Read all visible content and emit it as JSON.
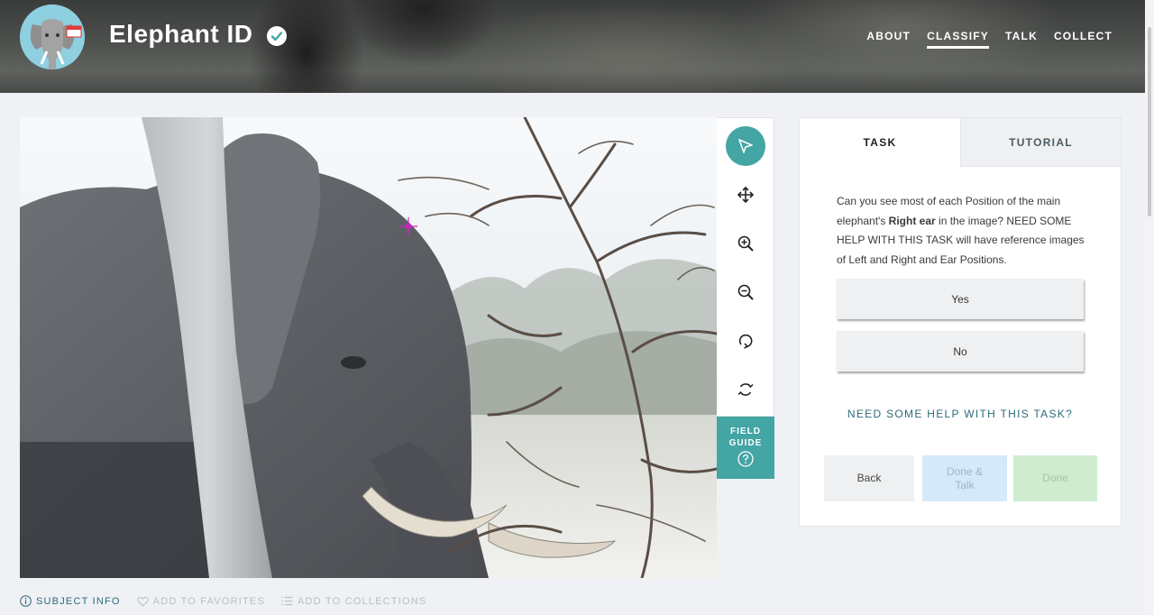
{
  "header": {
    "title": "Elephant ID",
    "nav": [
      {
        "label": "ABOUT",
        "active": false
      },
      {
        "label": "CLASSIFY",
        "active": true
      },
      {
        "label": "TALK",
        "active": false
      },
      {
        "label": "COLLECT",
        "active": false
      }
    ]
  },
  "toolbar": {
    "tools": [
      "pointer-icon",
      "pan-icon",
      "zoom-in-icon",
      "zoom-out-icon",
      "rotate-icon",
      "reset-icon"
    ],
    "active_tool": "pointer-icon",
    "field_guide_label": "FIELD GUIDE"
  },
  "task_panel": {
    "tabs": {
      "task": "TASK",
      "tutorial": "TUTORIAL"
    },
    "active_tab": "TASK",
    "question": {
      "before": "Can you see most of each Position of the main elephant's ",
      "bold": "Right ear",
      "after": " in the image? NEED SOME HELP WITH THIS TASK will have reference images of Left and Right and Ear Positions."
    },
    "answers": [
      "Yes",
      "No"
    ],
    "help_link": "NEED SOME HELP WITH THIS TASK?",
    "buttons": {
      "back": "Back",
      "done_talk": "Done & Talk",
      "done": "Done"
    }
  },
  "footer": {
    "subject_info": "SUBJECT INFO",
    "add_favorites": "ADD TO FAVORITES",
    "add_collections": "ADD TO COLLECTIONS"
  },
  "colors": {
    "accent": "#43a5a4",
    "link": "#2b6a7b",
    "done_talk_bg": "#d5e9fb",
    "done_bg": "#cfeccf",
    "marker": "#d321c8"
  }
}
